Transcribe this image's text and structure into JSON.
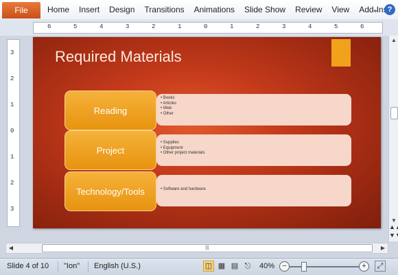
{
  "ribbon": {
    "file_label": "File",
    "tabs": [
      "Home",
      "Insert",
      "Design",
      "Transitions",
      "Animations",
      "Slide Show",
      "Review",
      "View",
      "Add-Ins"
    ],
    "minimize_icon": "chevron-down-icon",
    "help_icon": "help-icon",
    "help_label": "?"
  },
  "ruler": {
    "horizontal_numbers": [
      "6",
      "5",
      "4",
      "3",
      "2",
      "1",
      "0",
      "1",
      "2",
      "3",
      "4",
      "5",
      "6"
    ],
    "vertical_numbers": [
      "3",
      "2",
      "1",
      "0",
      "1",
      "2",
      "3"
    ]
  },
  "slide": {
    "title": "Required Materials",
    "accent_color": "#f0a21c",
    "rows": [
      {
        "label": "Reading",
        "bullets": [
          "Books",
          "Articles",
          "Web",
          "Other"
        ]
      },
      {
        "label": "Project",
        "bullets": [
          "Supplies",
          "Equipment",
          "Other project materials"
        ]
      },
      {
        "label": "Technology/Tools",
        "bullets": [
          "Software and hardware"
        ]
      }
    ]
  },
  "statusbar": {
    "slide_info": "Slide 4 of 10",
    "theme": "\"Ion\"",
    "language": "English (U.S.)",
    "zoom": "40%",
    "zoom_minus": "−",
    "zoom_plus": "+"
  },
  "colors": {
    "file_tab": "#d0581f",
    "slide_background": "#c43a1b",
    "shape_fill": "#f0a21c",
    "panel_fill": "#f6d7c9"
  }
}
